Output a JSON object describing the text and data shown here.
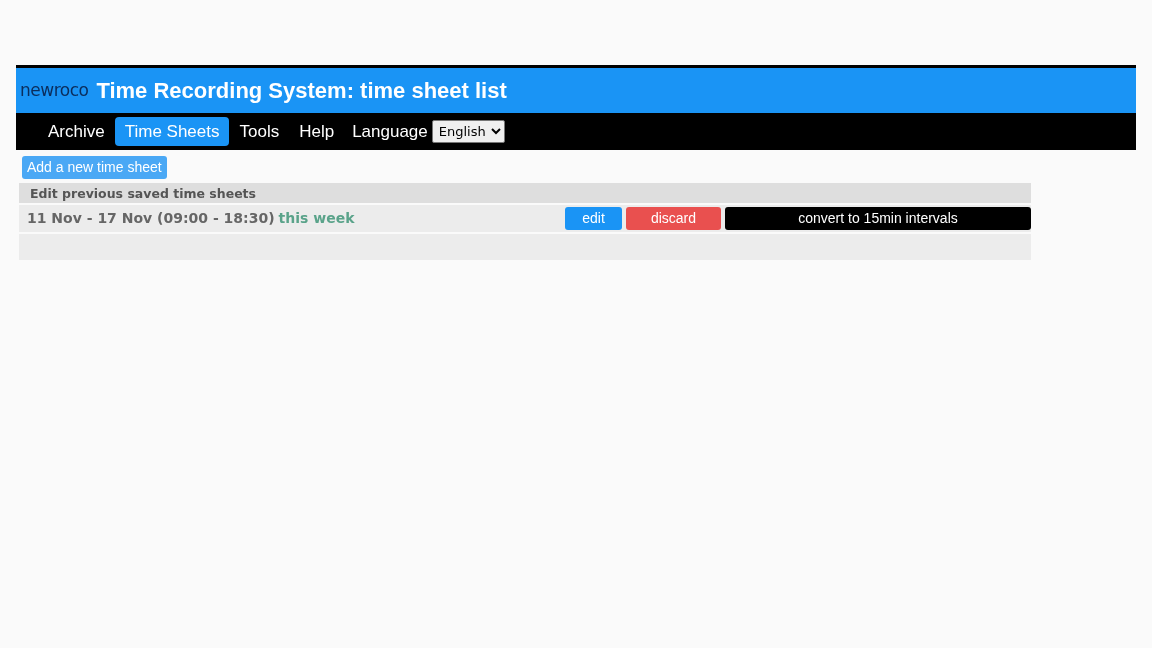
{
  "header": {
    "logo": "newroco",
    "title": "Time Recording System: time sheet list"
  },
  "nav": {
    "items": [
      {
        "label": "Archive",
        "selected": false
      },
      {
        "label": "Time Sheets",
        "selected": true
      },
      {
        "label": "Tools",
        "selected": false
      },
      {
        "label": "Help",
        "selected": false
      }
    ],
    "language_label": "Language",
    "language": "English"
  },
  "add_button": "Add a new time sheet",
  "list": {
    "heading": "Edit previous saved time sheets",
    "rows": [
      {
        "range": "11 Nov - 17 Nov (09:00 - 18:30)",
        "note": "this week",
        "actions": [
          {
            "label": "edit",
            "kind": "edit"
          },
          {
            "label": "discard",
            "kind": "discard"
          },
          {
            "label": "convert to 15min intervals",
            "kind": "convert"
          }
        ]
      }
    ]
  }
}
